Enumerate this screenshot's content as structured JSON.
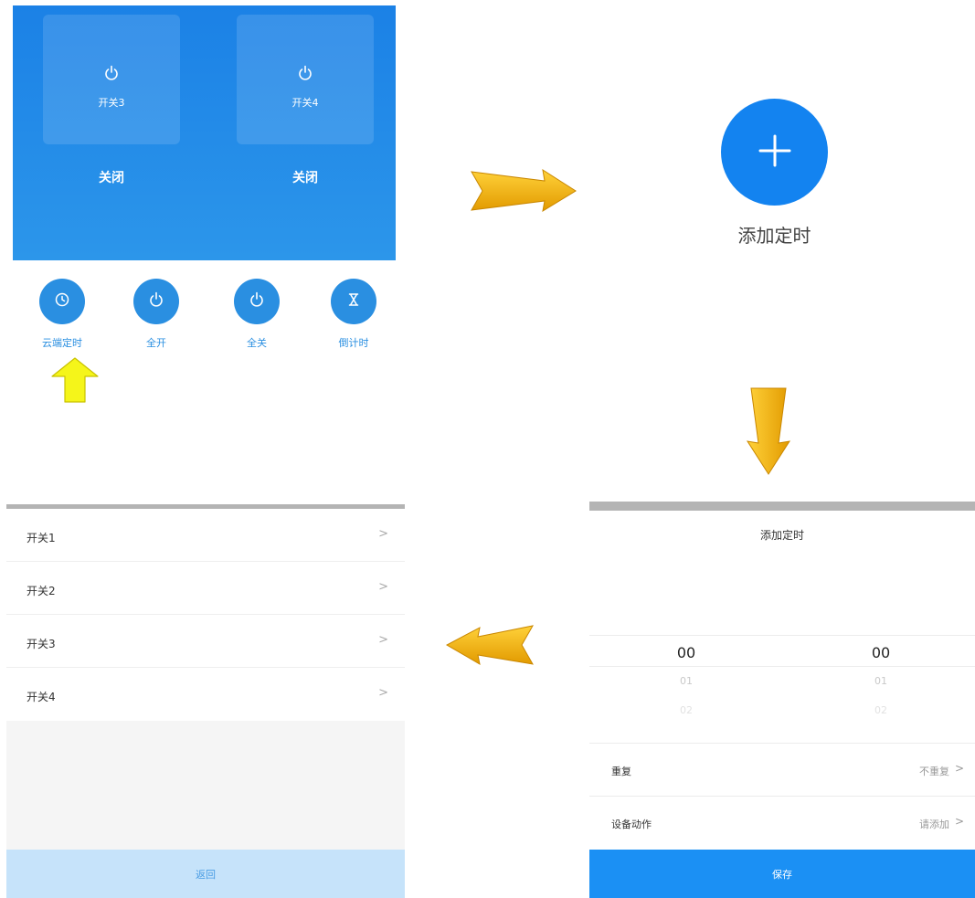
{
  "panel1": {
    "tiles": [
      {
        "label": "开关3",
        "state": "关闭"
      },
      {
        "label": "开关4",
        "state": "关闭"
      }
    ],
    "actions": [
      {
        "label": "云端定时",
        "icon": "clock-icon"
      },
      {
        "label": "全开",
        "icon": "power-icon"
      },
      {
        "label": "全关",
        "icon": "power-icon"
      },
      {
        "label": "倒计时",
        "icon": "hourglass-icon"
      }
    ]
  },
  "panel2": {
    "add_label": "添加定时"
  },
  "panel3": {
    "title": "添加定时",
    "hours": {
      "selected": "00",
      "next1": "01",
      "next2": "02"
    },
    "minutes": {
      "selected": "00",
      "next1": "01",
      "next2": "02"
    },
    "repeat": {
      "label": "重复",
      "value": "不重复"
    },
    "device_action": {
      "label": "设备动作",
      "value": "请添加"
    },
    "save_label": "保存"
  },
  "panel4": {
    "items": [
      {
        "label": "开关1"
      },
      {
        "label": "开关2"
      },
      {
        "label": "开关3"
      },
      {
        "label": "开关4"
      }
    ],
    "back_label": "返回"
  },
  "colors": {
    "primary_blue": "#1b81e6",
    "add_blue": "#1383f0",
    "save_blue": "#1b90f4",
    "back_light_blue": "#c6e3fa",
    "arrow_orange": "#f0b000",
    "arrow_yellow": "#f5f51a"
  }
}
